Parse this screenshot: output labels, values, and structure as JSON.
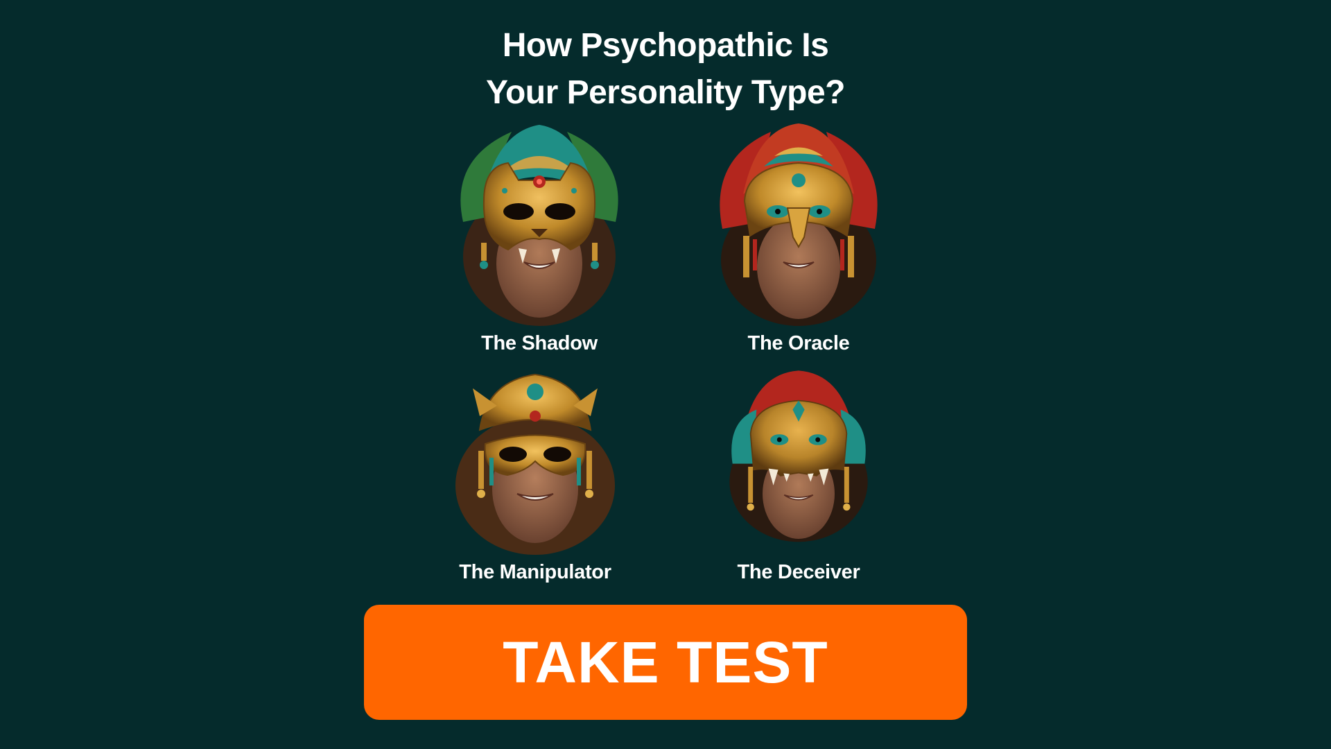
{
  "headline": {
    "line1": "How Psychopathic Is",
    "line2": "Your Personality Type?"
  },
  "personalities": [
    {
      "name": "The Shadow",
      "mask": "jaguar-mask"
    },
    {
      "name": "The Oracle",
      "mask": "eagle-mask"
    },
    {
      "name": "The Manipulator",
      "mask": "jeweled-masquerade-mask"
    },
    {
      "name": "The Deceiver",
      "mask": "fanged-serpent-mask"
    }
  ],
  "cta": {
    "label": "TAKE TEST"
  },
  "colors": {
    "background": "#052b2c",
    "accent": "#ff6600",
    "text": "#ffffff",
    "gold": "#c89232",
    "teal": "#1f8f86",
    "red": "#b3261e",
    "feather_green": "#2f7a3a"
  }
}
